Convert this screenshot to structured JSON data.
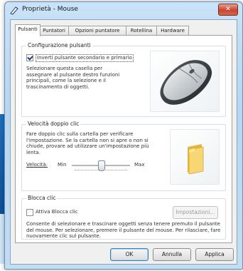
{
  "window": {
    "title": "Proprietà - Mouse",
    "close_label": "✕"
  },
  "tabs": [
    {
      "label": "Pulsanti"
    },
    {
      "label": "Puntatori"
    },
    {
      "label": "Opzioni puntatore"
    },
    {
      "label": "Rotellina"
    },
    {
      "label": "Hardware"
    }
  ],
  "buttons_config": {
    "title": "Configurazione pulsanti",
    "checkbox_label": "Inverti pulsante secondario e primario",
    "checked": true,
    "description": "Selezionare questa casella per assegnare al pulsante destro funzioni principali, come la selezione e il trascinamento di oggetti."
  },
  "double_click": {
    "title": "Velocità doppio clic",
    "description": "Fare doppio clic sulla cartella per verificare l'impostazione. Se la cartella non si apre o non si chiude, provare ad utilizzare un'impostazione più lenta.",
    "speed_label": "Velocità:",
    "min_label": "Min",
    "max_label": "Max",
    "speed_value_fraction": 0.5
  },
  "click_lock": {
    "title": "Blocca clic",
    "checkbox_label": "Attiva Blocca clic",
    "checked": false,
    "settings_button": "Impostazioni...",
    "description": "Consente di selezionare e trascinare oggetti senza tenere premuto il pulsante del mouse. Per selezionare, premere il pulsante del mouse. Per rilasciare, fare nuovamente clic sul pulsante."
  },
  "footer": {
    "ok": "OK",
    "cancel": "Annulla",
    "apply": "Applica"
  },
  "colors": {
    "title_bar": "#b6d6f1",
    "close_button": "#c8442e",
    "folder": "#f2c94c"
  }
}
